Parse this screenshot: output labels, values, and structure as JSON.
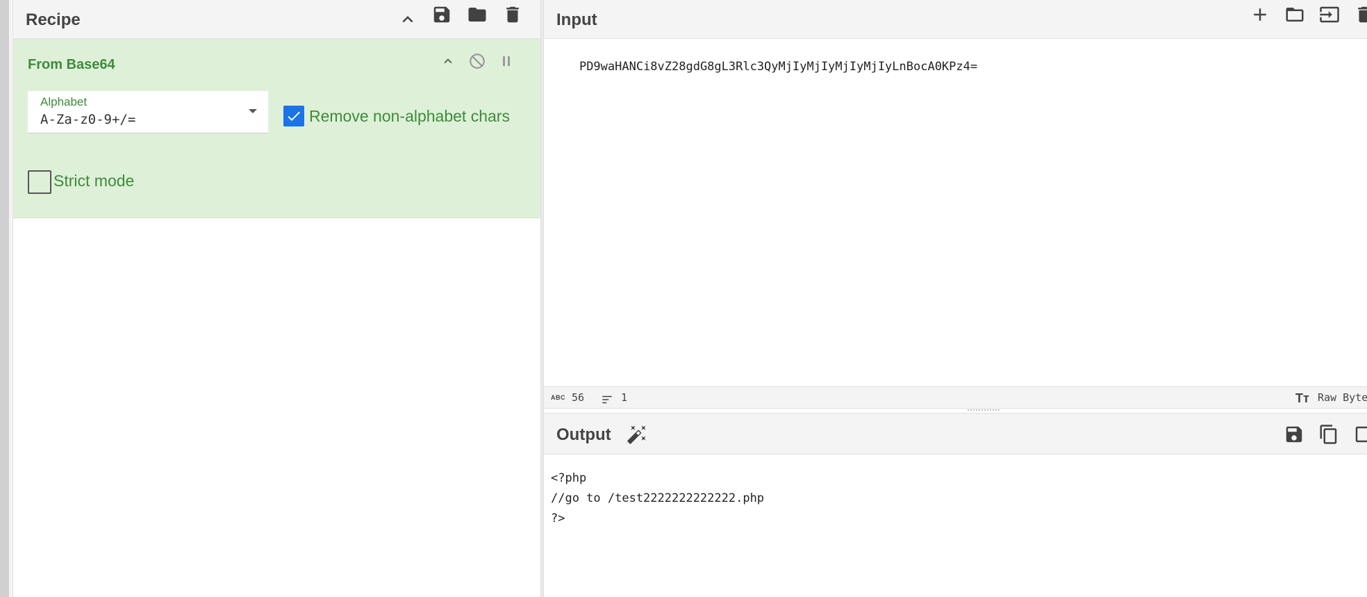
{
  "recipe": {
    "title": "Recipe",
    "operation": {
      "name": "From Base64",
      "alphabet_label": "Alphabet",
      "alphabet_value": "A-Za-z0-9+/=",
      "remove_non_alpha_label": "Remove non-alphabet chars",
      "remove_non_alpha_checked": true,
      "strict_mode_label": "Strict mode",
      "strict_mode_checked": false
    }
  },
  "input": {
    "title": "Input",
    "text": "PD9waHANCi8vZ28gdG8gL3Rlc3QyMjIyMjIyMjIyMjIyLnBocA0KPz4=",
    "stats": {
      "length": "56",
      "lines": "1"
    },
    "encoding_label": "Raw Bytes"
  },
  "output": {
    "title": "Output",
    "lines": [
      "<?php",
      "//go to /test2222222222222.php",
      "?>"
    ]
  },
  "colors": {
    "operation_bg": "#dff0d8",
    "operation_text": "#3d8b3d",
    "checkbox_on": "#1a73e8"
  }
}
